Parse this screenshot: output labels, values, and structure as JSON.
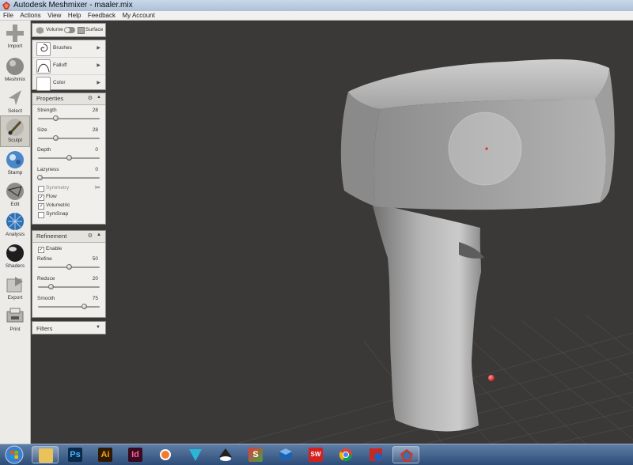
{
  "window": {
    "title": "Autodesk Meshmixer - maaler.mix"
  },
  "menu": [
    "File",
    "Actions",
    "View",
    "Help",
    "Feedback",
    "My Account"
  ],
  "tools": [
    {
      "label": "Import",
      "icon": "plus-icon"
    },
    {
      "label": "Meshmix",
      "icon": "meshmix-sphere-icon"
    },
    {
      "label": "Select",
      "icon": "select-arrow-icon"
    },
    {
      "label": "Sculpt",
      "icon": "sculpt-brush-icon",
      "active": true
    },
    {
      "label": "Stamp",
      "icon": "stamp-icon"
    },
    {
      "label": "Edit",
      "icon": "edit-sphere-icon"
    },
    {
      "label": "Analysis",
      "icon": "analysis-sphere-icon"
    },
    {
      "label": "Shaders",
      "icon": "shaders-sphere-icon"
    },
    {
      "label": "Export",
      "icon": "export-icon"
    },
    {
      "label": "Print",
      "icon": "print-icon"
    }
  ],
  "mode": {
    "volume": "Volume",
    "surface": "Surface"
  },
  "brush_panel": {
    "brushes": "Brushes",
    "falloff": "Falloff",
    "color": "Color"
  },
  "properties": {
    "title": "Properties",
    "strength": {
      "label": "Strength",
      "value": 28
    },
    "size": {
      "label": "Size",
      "value": 28
    },
    "depth": {
      "label": "Depth",
      "value": 0
    },
    "lazyness": {
      "label": "Lazyness",
      "value": 0
    },
    "symmetry": {
      "label": "Symmetry",
      "checked": false
    },
    "flow": {
      "label": "Flow",
      "checked": true
    },
    "volumetric": {
      "label": "Volumetric",
      "checked": true
    },
    "symsnap": {
      "label": "SymSnap",
      "checked": false
    }
  },
  "refinement": {
    "title": "Refinement",
    "enable": {
      "label": "Enable",
      "checked": true
    },
    "refine": {
      "label": "Refine",
      "value": 50
    },
    "reduce": {
      "label": "Reduce",
      "value": 20
    },
    "smooth": {
      "label": "Smooth",
      "value": 75
    }
  },
  "filters": {
    "title": "Filters"
  },
  "taskbar": {
    "apps": [
      {
        "icon": "file-explorer-icon",
        "text": ""
      },
      {
        "icon": "photoshop-icon",
        "text": "Ps"
      },
      {
        "icon": "illustrator-icon",
        "text": "Ai"
      },
      {
        "icon": "indesign-icon",
        "text": "Id"
      },
      {
        "icon": "blender-icon",
        "text": ""
      },
      {
        "icon": "vectorizer-icon",
        "text": ""
      },
      {
        "icon": "inkscape-icon",
        "text": ""
      },
      {
        "icon": "sketchup-icon",
        "text": "S"
      },
      {
        "icon": "virtualbox-icon",
        "text": ""
      },
      {
        "icon": "solidworks-icon",
        "text": "SW"
      },
      {
        "icon": "chrome-icon",
        "text": ""
      },
      {
        "icon": "3d-app-icon",
        "text": ""
      },
      {
        "icon": "meshmixer-icon",
        "text": ""
      }
    ]
  },
  "colors": {
    "viewport": "#3b3937",
    "accent": "#e04040"
  }
}
